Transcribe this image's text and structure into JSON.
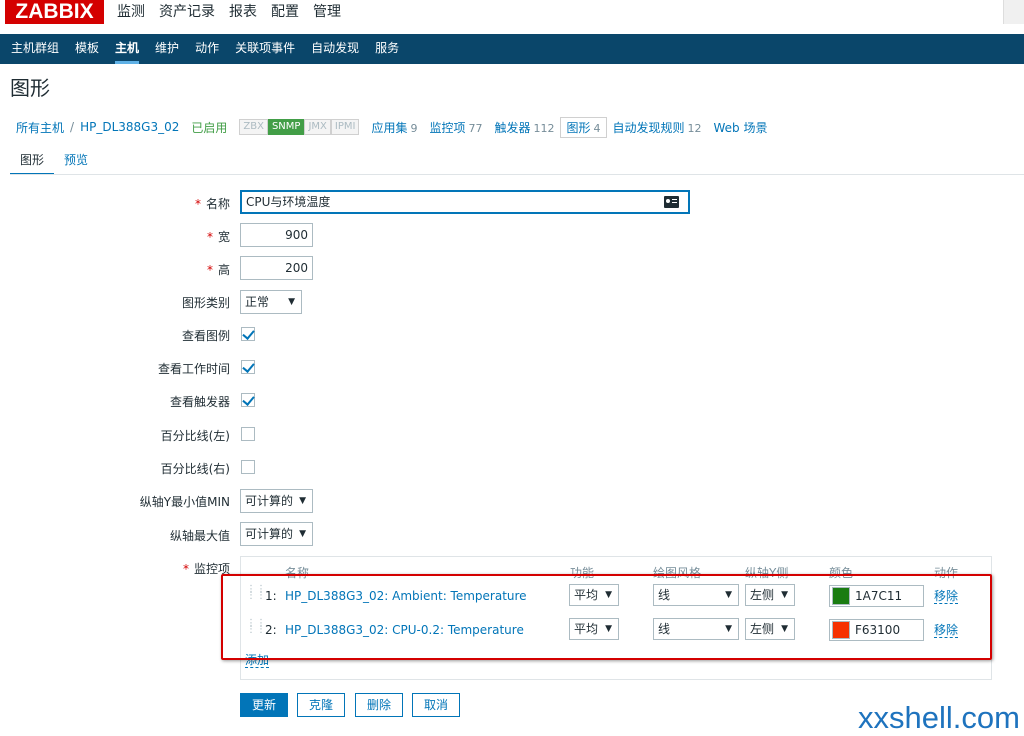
{
  "logo": "ZABBIX",
  "top_menu": [
    "监测",
    "资产记录",
    "报表",
    "配置",
    "管理"
  ],
  "sub_menu": [
    "主机群组",
    "模板",
    "主机",
    "维护",
    "动作",
    "关联项事件",
    "自动发现",
    "服务"
  ],
  "page_title": "图形",
  "breadcrumbs": {
    "all_hosts": "所有主机",
    "host": "HP_DL388G3_02",
    "status": "已启用",
    "protocols": [
      "ZBX",
      "SNMP",
      "JMX",
      "IPMI"
    ],
    "applications": {
      "label": "应用集",
      "count": "9"
    },
    "items": {
      "label": "监控项",
      "count": "77"
    },
    "triggers": {
      "label": "触发器",
      "count": "112"
    },
    "graphs": {
      "label": "图形",
      "count": "4"
    },
    "discovery": {
      "label": "自动发现规则",
      "count": "12"
    },
    "web": {
      "label": "Web 场景"
    }
  },
  "tabs": [
    "图形",
    "预览"
  ],
  "form": {
    "name_label": "名称",
    "name_value": "CPU与环境温度",
    "width_label": "宽",
    "width_value": "900",
    "height_label": "高",
    "height_value": "200",
    "graph_type_label": "图形类别",
    "graph_type_value": "正常",
    "show_legend_label": "查看图例",
    "show_working_time_label": "查看工作时间",
    "show_triggers_label": "查看触发器",
    "percentile_left_label": "百分比线(左)",
    "percentile_right_label": "百分比线(右)",
    "ymin_label": "纵轴Y最小值MIN",
    "ymin_value": "可计算的",
    "ymax_label": "纵轴最大值",
    "ymax_value": "可计算的",
    "items_label": "监控项"
  },
  "items_table": {
    "headers": {
      "name": "名称",
      "function": "功能",
      "draw_style": "绘图风格",
      "y_axis": "纵轴Y侧",
      "color": "颜色",
      "action": "动作"
    },
    "rows": [
      {
        "index": "1:",
        "name": "HP_DL388G3_02: Ambient: Temperature",
        "function": "平均",
        "draw_style": "线",
        "y_axis": "左侧",
        "color": "1A7C11",
        "color_hex": "#1a7c11",
        "remove": "移除"
      },
      {
        "index": "2:",
        "name": "HP_DL388G3_02: CPU-0.2: Temperature",
        "function": "平均",
        "draw_style": "线",
        "y_axis": "左侧",
        "color": "F63100",
        "color_hex": "#f63100",
        "remove": "移除"
      }
    ],
    "add": "添加"
  },
  "buttons": {
    "update": "更新",
    "clone": "克隆",
    "delete": "删除",
    "cancel": "取消"
  },
  "watermark": "xxshell.com"
}
